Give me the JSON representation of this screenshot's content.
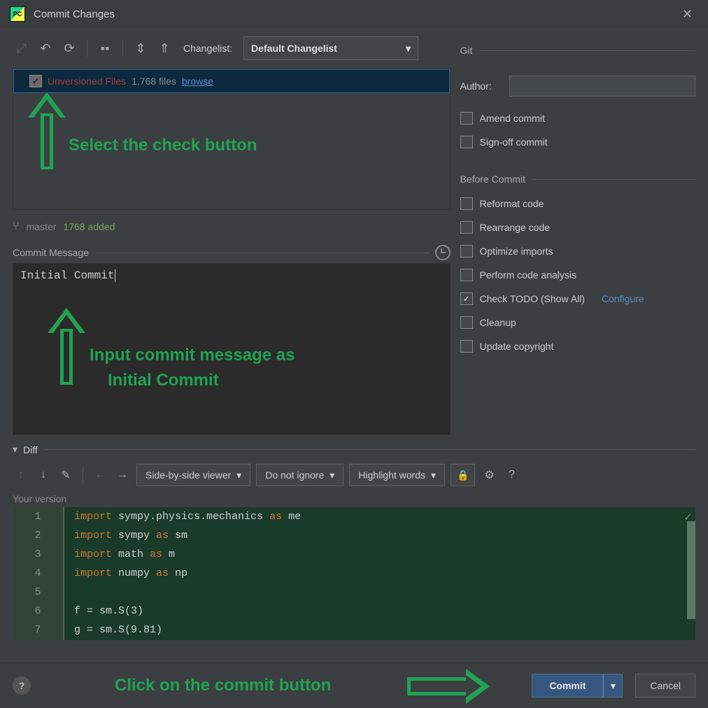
{
  "window": {
    "title": "Commit Changes",
    "app_icon_text": "PC"
  },
  "toolbar": {
    "changelist_label": "Changelist:",
    "changelist_value": "Default Changelist"
  },
  "files": {
    "unversioned_label": "Unversioned Files",
    "count_label": "1,768 files",
    "browse": "browse"
  },
  "branch": {
    "name": "master",
    "added": "1768 added"
  },
  "commit_message": {
    "section": "Commit Message",
    "value": "Initial Commit"
  },
  "git": {
    "section": "Git",
    "author_label": "Author:",
    "author_value": "",
    "amend": "Amend commit",
    "signoff": "Sign-off commit",
    "before": "Before Commit",
    "opts": {
      "reformat": "Reformat code",
      "rearrange": "Rearrange code",
      "optimize": "Optimize imports",
      "analysis": "Perform code analysis",
      "todo": "Check TODO (Show All)",
      "configure": "Configure",
      "cleanup": "Cleanup",
      "copyright": "Update copyright"
    }
  },
  "diff": {
    "section": "Diff",
    "viewer": "Side-by-side viewer",
    "ignore": "Do not ignore",
    "highlight": "Highlight words",
    "your_version": "Your version",
    "code": [
      {
        "n": "1",
        "t": "import sympy.physics.mechanics as me"
      },
      {
        "n": "2",
        "t": "import sympy as sm"
      },
      {
        "n": "3",
        "t": "import math as m"
      },
      {
        "n": "4",
        "t": "import numpy as np"
      },
      {
        "n": "5",
        "t": ""
      },
      {
        "n": "6",
        "t": "f = sm.S(3)"
      },
      {
        "n": "7",
        "t": "g = sm.S(9.81)"
      }
    ]
  },
  "footer": {
    "commit": "Commit",
    "cancel": "Cancel"
  },
  "anno": {
    "a1": "Select the check button",
    "a2": "Input commit message as",
    "a2b": "Initial Commit",
    "a3": "Click on the commit button"
  }
}
